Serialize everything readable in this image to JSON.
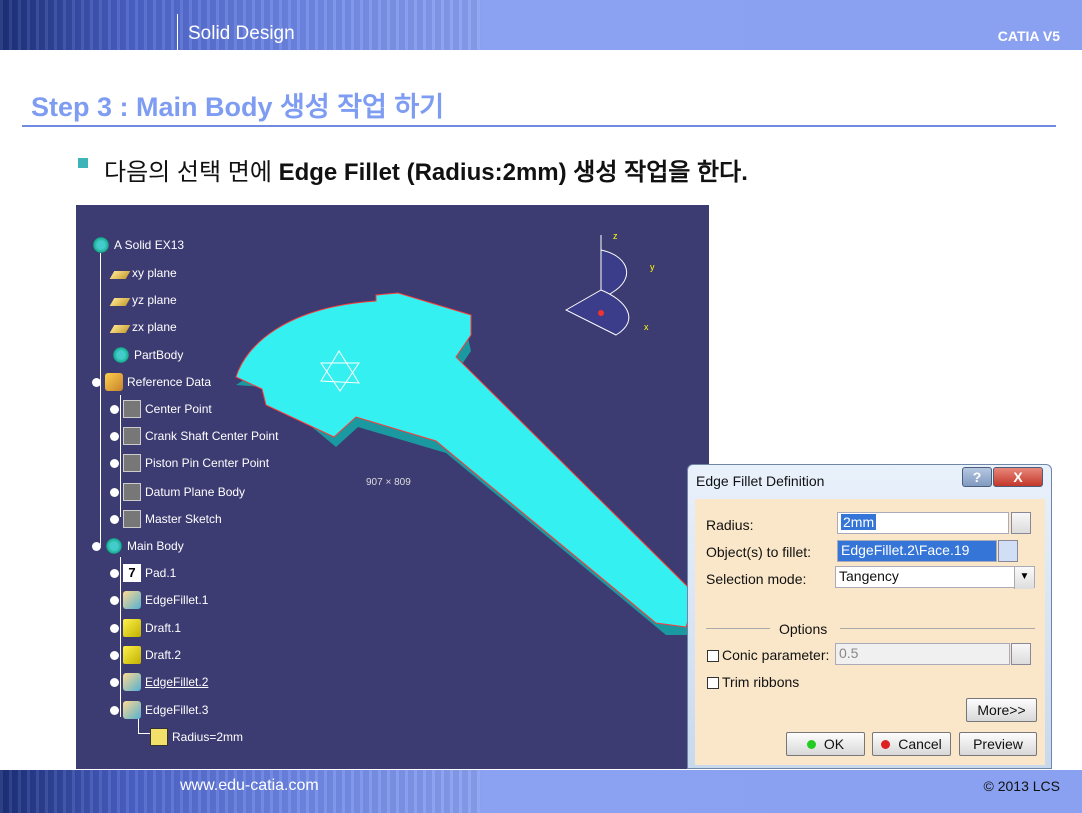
{
  "header": {
    "section": "Solid Design",
    "brand": "CATIA V5"
  },
  "step_title": "Step 3 : Main Body 생성 작업 하기",
  "instruction": {
    "pre": "다음의 선택 면에 ",
    "bold": "Edge Fillet (Radius:2mm)",
    "post": " 생성 작업을 한다."
  },
  "tree": {
    "root": "A Solid EX13",
    "items": [
      "xy plane",
      "yz plane",
      "zx plane",
      "PartBody",
      "Reference Data",
      "Center Point",
      "Crank Shaft Center Point",
      "Piston Pin Center Point",
      "Datum Plane Body",
      "Master Sketch",
      "Main Body",
      "Pad.1",
      "EdgeFillet.1",
      "Draft.1",
      "Draft.2",
      "EdgeFillet.2",
      "EdgeFillet.3",
      "Radius=2mm"
    ]
  },
  "viewport": {
    "coord_x": "907",
    "coord_sep": "×",
    "coord_y": "809",
    "axis_z": "z",
    "axis_y": "y",
    "axis_x": "x"
  },
  "dialog": {
    "title": "Edge Fillet Definition",
    "help_label": "?",
    "close_label": "X",
    "radius_label": "Radius:",
    "radius_value": "2mm",
    "objects_label": "Object(s) to fillet:",
    "objects_value": "EdgeFillet.2\\Face.19",
    "selection_label": "Selection mode:",
    "selection_value": "Tangency",
    "options_label": "Options",
    "conic_label": "Conic parameter:",
    "conic_value": "0.5",
    "trim_label": "Trim ribbons",
    "more_label": "More>>",
    "ok_label": "OK",
    "cancel_label": "Cancel",
    "preview_label": "Preview"
  },
  "footer": {
    "url": "www.edu-catia.com",
    "copyright": "© 2013 LCS"
  }
}
